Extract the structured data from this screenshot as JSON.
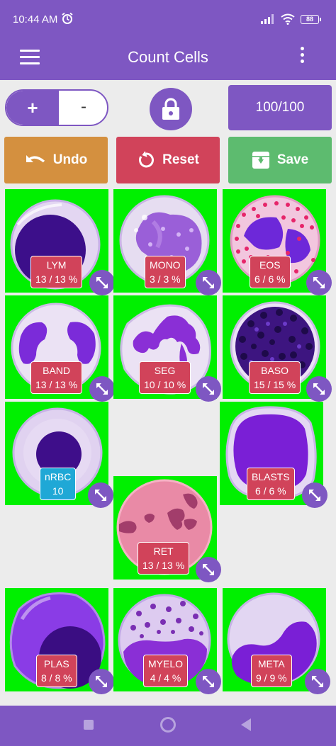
{
  "status": {
    "time": "10:44 AM",
    "battery": "88"
  },
  "appbar": {
    "title": "Count Cells"
  },
  "controls": {
    "plus_label": "+",
    "minus_label": "-",
    "counter": "100/100",
    "undo_label": "Undo",
    "reset_label": "Reset",
    "save_label": "Save"
  },
  "cells": {
    "lym": {
      "name": "LYM",
      "count": "13 / 13 %"
    },
    "mono": {
      "name": "MONO",
      "count": "3 / 3 %"
    },
    "eos": {
      "name": "EOS",
      "count": "6 / 6 %"
    },
    "band": {
      "name": "BAND",
      "count": "13 / 13 %"
    },
    "seg": {
      "name": "SEG",
      "count": "10 / 10 %"
    },
    "baso": {
      "name": "BASO",
      "count": "15 / 15 %"
    },
    "nrbc": {
      "name": "nRBC",
      "count": "10"
    },
    "blasts": {
      "name": "BLASTS",
      "count": "6 / 6 %"
    },
    "ret": {
      "name": "RET",
      "count": "13 / 13 %"
    },
    "plas": {
      "name": "PLAS",
      "count": "8 / 8 %"
    },
    "myelo": {
      "name": "MYELO",
      "count": "4 / 4 %"
    },
    "meta": {
      "name": "META",
      "count": "9 / 9 %"
    }
  },
  "colors": {
    "primary": "#7e57c2",
    "tile_bg": "#00f000",
    "label_red": "#d1435a",
    "label_blue": "#1fa8d6",
    "undo": "#d4903f",
    "reset": "#d1435a",
    "save": "#5dbb6f"
  },
  "icons": {
    "menu": "hamburger-icon",
    "more": "more-vert-icon",
    "lock": "lock-icon",
    "undo": "undo-icon",
    "reset": "refresh-icon",
    "save": "save-archive-icon",
    "expand": "expand-diagonal-icon"
  }
}
